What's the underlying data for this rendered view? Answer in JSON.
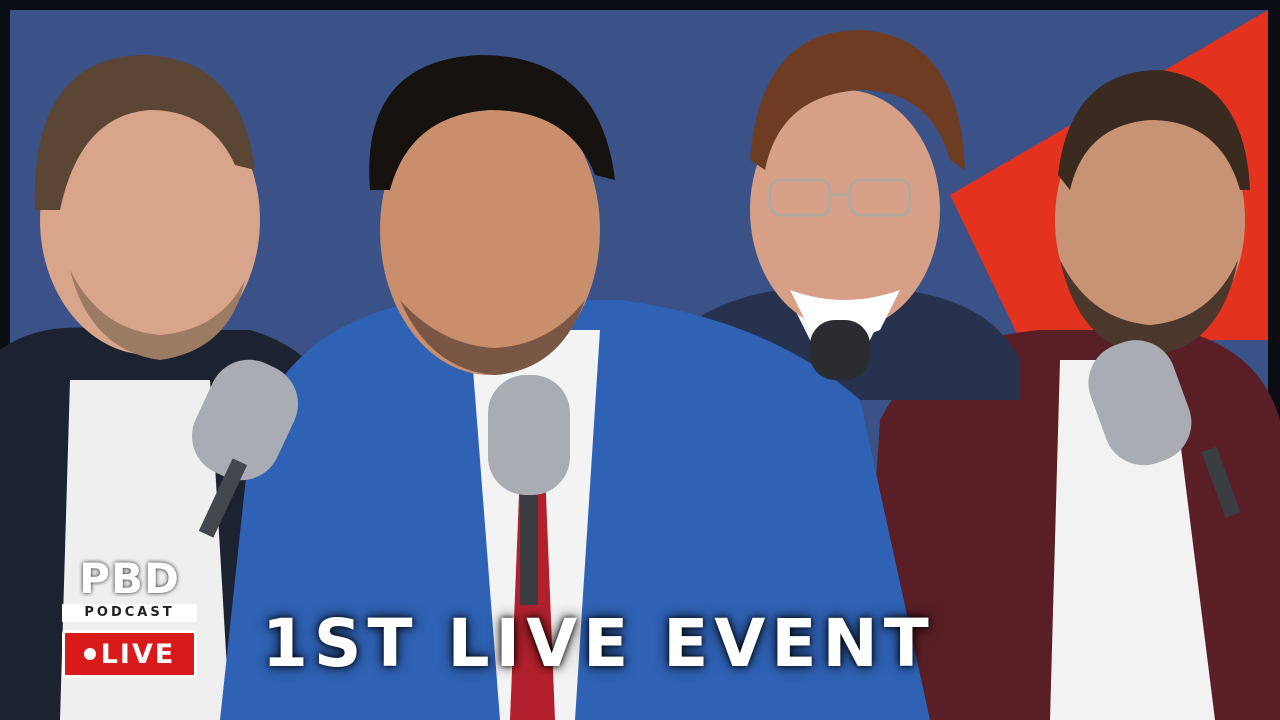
{
  "colors": {
    "backdrop_blue": "#3a5287",
    "backdrop_red": "#e3331f",
    "frame_dark": "#0b0d14",
    "live_red": "#d91a1a",
    "text_white": "#ffffff"
  },
  "logo": {
    "brand": "PBD",
    "subtitle": "PODCAST",
    "live_label": "LIVE"
  },
  "headline": "1ST LIVE EVENT",
  "people": [
    {
      "name": "guest-left",
      "suit": "#1d2230",
      "shirt": "#efefef"
    },
    {
      "name": "host-center",
      "suit": "#2f62b5",
      "shirt": "#f3f3f3"
    },
    {
      "name": "guest-glasses",
      "suit": "#27324f",
      "shirt": "#f4f4f4"
    },
    {
      "name": "guest-right",
      "suit": "#5a1f26",
      "shirt": "#f2f2f2"
    }
  ],
  "icons": [
    "microphone-icon",
    "live-dot-icon"
  ]
}
